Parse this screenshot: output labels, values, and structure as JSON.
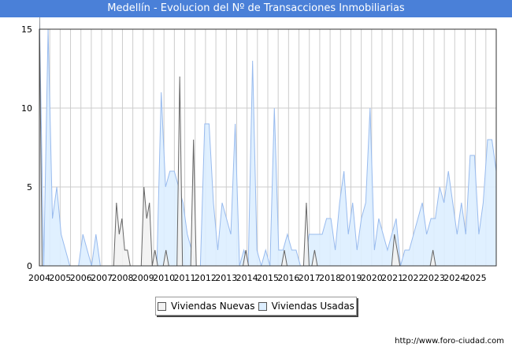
{
  "title": "Medellín - Evolucion del Nº de Transacciones Inmobiliarias",
  "footer_url": "http://www.foro-ciudad.com",
  "colors": {
    "title_bg": "#4a80d8",
    "nuevas_fill": "#f2f2f2",
    "nuevas_line": "#666666",
    "usadas_fill": "#ddeeff",
    "usadas_line": "#99bbee",
    "grid": "#cccccc"
  },
  "chart_data": {
    "type": "area",
    "title": "Medellín - Evolucion del Nº de Transacciones Inmobiliarias",
    "xlabel": "",
    "ylabel": "",
    "ylim": [
      0,
      15
    ],
    "yticks": [
      0,
      5,
      10,
      15
    ],
    "grid": true,
    "legend_position": "bottom-center",
    "x_tick_labels": [
      "2004",
      "2005",
      "2006",
      "2007",
      "2008",
      "2009",
      "2010",
      "2011",
      "2012",
      "2013",
      "2014",
      "2015",
      "2016",
      "2017",
      "2018",
      "2019",
      "2020",
      "2021",
      "2022",
      "2023",
      "2024",
      "2025"
    ],
    "x_start_year": 2004,
    "x_end_year": 2025,
    "series": [
      {
        "name": "Viviendas Nuevas",
        "values": [
          16,
          0,
          0,
          0,
          0,
          0,
          0,
          0,
          0,
          0,
          0,
          0,
          0,
          0,
          0,
          0,
          0,
          0,
          0,
          0,
          0,
          0,
          0,
          0,
          0,
          0,
          0,
          0,
          4,
          2,
          3,
          1,
          1,
          0,
          0,
          0,
          0,
          0,
          5,
          3,
          4,
          0,
          1,
          0,
          0,
          0,
          1,
          0,
          0,
          0,
          0,
          12,
          0,
          0,
          0,
          0,
          8,
          0,
          0,
          0,
          0,
          0,
          0,
          0,
          0,
          0,
          0,
          0,
          0,
          0,
          0,
          0,
          0,
          0,
          0,
          1,
          0,
          0,
          0,
          0,
          0,
          0,
          0,
          0,
          0,
          0,
          0,
          0,
          0,
          1,
          0,
          0,
          0,
          0,
          0,
          0,
          0,
          4,
          0,
          0,
          1,
          0,
          0,
          0,
          0,
          0,
          0,
          0,
          0,
          0,
          0,
          0,
          0,
          0,
          0,
          0,
          0,
          0,
          0,
          0,
          0,
          0,
          0,
          0,
          0,
          0,
          0,
          0,
          0,
          2,
          1,
          0,
          0,
          0,
          0,
          0,
          0,
          0,
          0,
          0,
          0,
          0,
          0,
          1,
          0,
          0,
          0,
          0,
          0,
          0,
          0,
          0,
          0,
          0,
          0,
          0,
          0,
          0,
          0,
          0,
          0,
          0,
          0,
          0,
          0,
          0,
          0
        ]
      },
      {
        "name": "Viviendas Usadas",
        "values": [
          16,
          0,
          15,
          3,
          5,
          2,
          1,
          0,
          0,
          0,
          2,
          1,
          0,
          2,
          0,
          0,
          0,
          0,
          0,
          0,
          0,
          0,
          0,
          0,
          0,
          0,
          0,
          0,
          11,
          5,
          6,
          6,
          5,
          4,
          2,
          1,
          0,
          0,
          9,
          9,
          4,
          1,
          4,
          3,
          2,
          9,
          0,
          1,
          0,
          13,
          1,
          0,
          1,
          0,
          10,
          1,
          1,
          2,
          1,
          1,
          0,
          0,
          2,
          2,
          2,
          2,
          3,
          3,
          1,
          4,
          6,
          2,
          4,
          1,
          3,
          4,
          10,
          1,
          3,
          2,
          1,
          2,
          3,
          0,
          1,
          1,
          2,
          3,
          4,
          2,
          3,
          3,
          5,
          4,
          6,
          4,
          2,
          4,
          2,
          7,
          7,
          2,
          4,
          8,
          8,
          6
        ]
      }
    ]
  }
}
